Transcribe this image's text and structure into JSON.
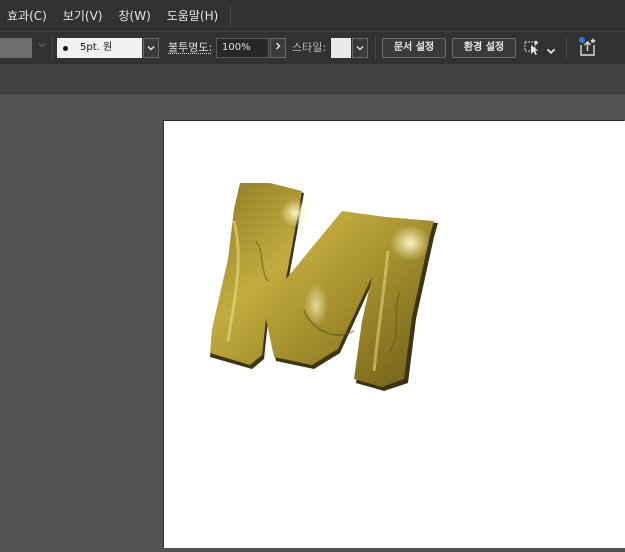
{
  "menu": {
    "items": [
      "효과(C)",
      "보기(V)",
      "창(W)",
      "도움말(H)"
    ]
  },
  "controlbar": {
    "stroke_value": "5pt. 원",
    "opacity_label": "불투명도:",
    "opacity_value": "100%",
    "style_label": "스타일:",
    "doc_setup_button": "문서 설정",
    "preferences_button": "환경 설정"
  },
  "artwork": {
    "letter": "M",
    "fill_color": "#b39d34",
    "highlight_color": "#f2e6a0",
    "shadow_color": "#5e4f12"
  },
  "colors": {
    "ui_dark": "#323232",
    "canvas_bg": "#535353",
    "artboard": "#ffffff",
    "accent_blue": "#2e7ad6"
  }
}
